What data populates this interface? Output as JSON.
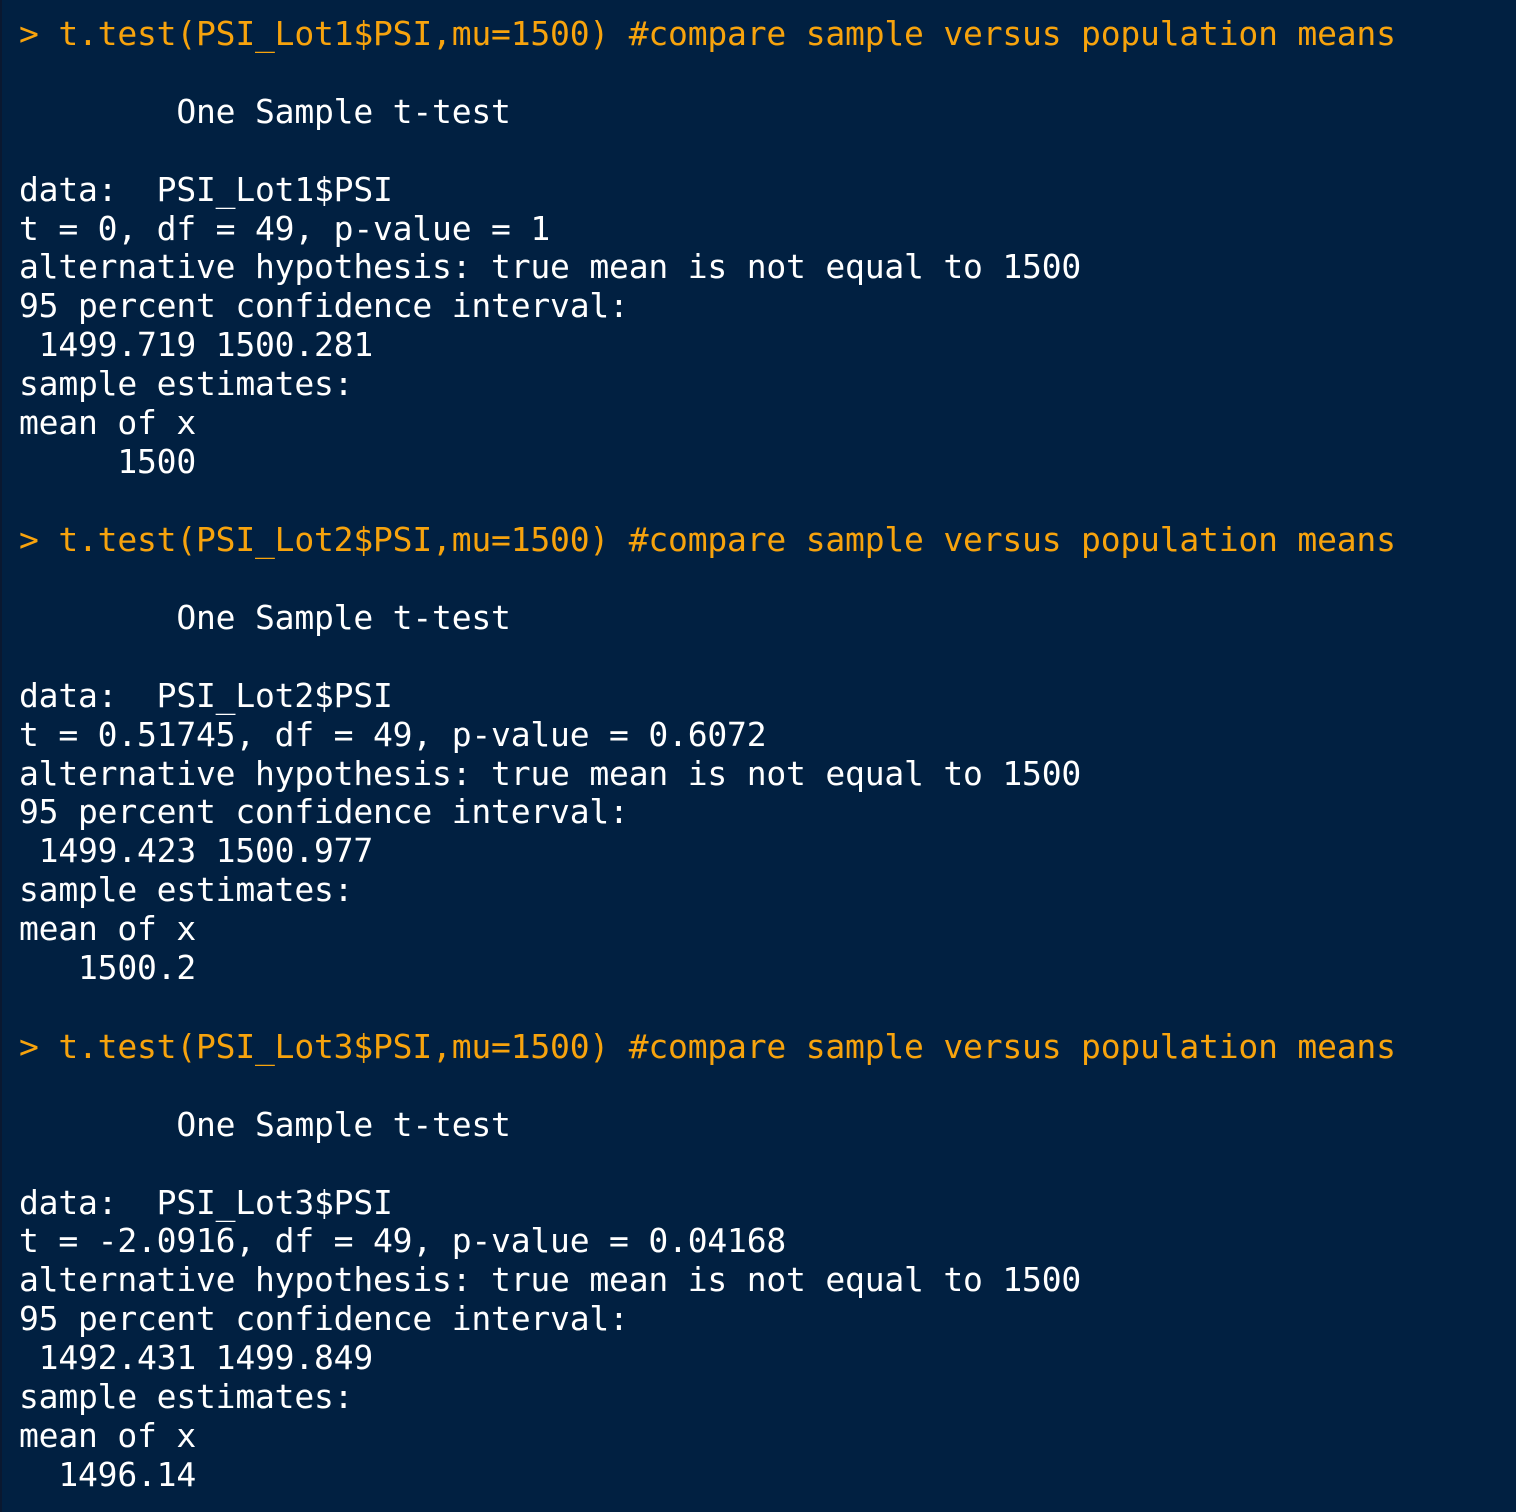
{
  "console": {
    "colors": {
      "background": "#012041",
      "output_text": "#ffffff",
      "command_text": "#f7a30d"
    },
    "blocks": [
      {
        "command": "> t.test(PSI_Lot1$PSI,mu=1500) #compare sample versus population means",
        "test_title": "        One Sample t-test",
        "data_line": "data:  PSI_Lot1$PSI",
        "stats_line": "t = 0, df = 49, p-value = 1",
        "alternative_line": "alternative hypothesis: true mean is not equal to 1500",
        "ci_label": "95 percent confidence interval:",
        "ci_values": " 1499.719 1500.281",
        "estimates_label": "sample estimates:",
        "mean_label": "mean of x",
        "mean_value": "     1500"
      },
      {
        "command": "> t.test(PSI_Lot2$PSI,mu=1500) #compare sample versus population means",
        "test_title": "        One Sample t-test",
        "data_line": "data:  PSI_Lot2$PSI",
        "stats_line": "t = 0.51745, df = 49, p-value = 0.6072",
        "alternative_line": "alternative hypothesis: true mean is not equal to 1500",
        "ci_label": "95 percent confidence interval:",
        "ci_values": " 1499.423 1500.977",
        "estimates_label": "sample estimates:",
        "mean_label": "mean of x",
        "mean_value": "   1500.2"
      },
      {
        "command": "> t.test(PSI_Lot3$PSI,mu=1500) #compare sample versus population means",
        "test_title": "        One Sample t-test",
        "data_line": "data:  PSI_Lot3$PSI",
        "stats_line": "t = -2.0916, df = 49, p-value = 0.04168",
        "alternative_line": "alternative hypothesis: true mean is not equal to 1500",
        "ci_label": "95 percent confidence interval:",
        "ci_values": " 1492.431 1499.849",
        "estimates_label": "sample estimates:",
        "mean_label": "mean of x",
        "mean_value": "  1496.14"
      }
    ]
  }
}
